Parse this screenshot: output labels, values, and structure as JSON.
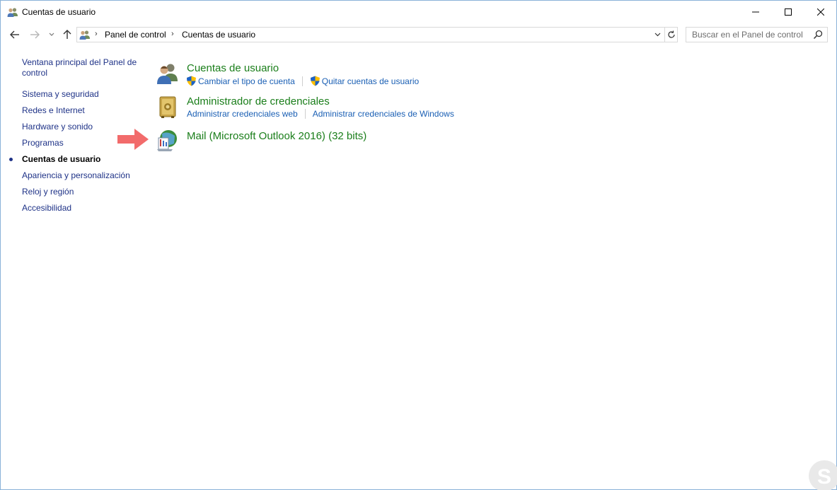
{
  "window": {
    "title": "Cuentas de usuario"
  },
  "address": {
    "breadcrumb": [
      "Panel de control",
      "Cuentas de usuario"
    ],
    "search_placeholder": "Buscar en el Panel de control"
  },
  "leftnav": {
    "home_link": "Ventana principal del Panel de control",
    "items": [
      {
        "label": "Sistema y seguridad",
        "current": false
      },
      {
        "label": "Redes e Internet",
        "current": false
      },
      {
        "label": "Hardware y sonido",
        "current": false
      },
      {
        "label": "Programas",
        "current": false
      },
      {
        "label": "Cuentas de usuario",
        "current": true
      },
      {
        "label": "Apariencia y personalización",
        "current": false
      },
      {
        "label": "Reloj y región",
        "current": false
      },
      {
        "label": "Accesibilidad",
        "current": false
      }
    ]
  },
  "categories": [
    {
      "title": "Cuentas de usuario",
      "icon": "users-icon",
      "links": [
        {
          "label": "Cambiar el tipo de cuenta",
          "shield": true
        },
        {
          "label": "Quitar cuentas de usuario",
          "shield": true
        }
      ]
    },
    {
      "title": "Administrador de credenciales",
      "icon": "credential-vault-icon",
      "links": [
        {
          "label": "Administrar credenciales web",
          "shield": false
        },
        {
          "label": "Administrar credenciales de Windows",
          "shield": false
        }
      ]
    },
    {
      "title": "Mail (Microsoft Outlook 2016) (32 bits)",
      "icon": "mail-icon",
      "links": []
    }
  ],
  "colors": {
    "category_title": "#1a7e1a",
    "link": "#1a5fb4",
    "nav_link": "#1e3287",
    "arrow": "#f26b6b",
    "window_border": "#8ab2d9"
  }
}
